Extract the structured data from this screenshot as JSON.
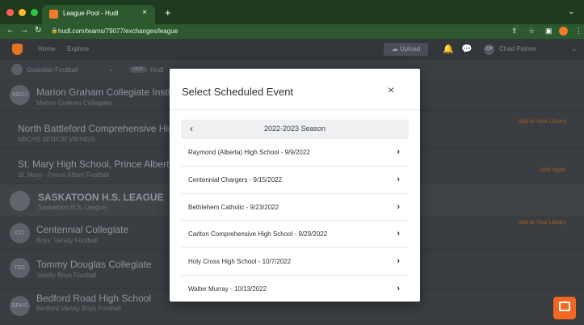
{
  "browser": {
    "tab_title": "League Pool - Hudl",
    "url": "hudl.com/teams/79077/exchanges/league"
  },
  "header": {
    "home_link": "Home",
    "explore_link": "Explore",
    "upload_label": "Upload",
    "avatar_initials": "CP",
    "user_name": "Chad Palmer"
  },
  "subbar": {
    "team_name": "Guardian Football",
    "pill_label": "NEW",
    "hudl_label": "Hudl"
  },
  "list": {
    "rows": [
      {
        "badge": "MGCI",
        "name": "Marion Graham Collegiate Institute",
        "sub": "Marion Graham Collegiate",
        "action": ""
      },
      {
        "badge": "",
        "name": "North Battleford Comprehensive High S",
        "sub": "NBCHS SENIOR VIKINGS",
        "action": "Add to Your Library"
      },
      {
        "badge": "",
        "name": "St. Mary High School, Prince Albert, Sa",
        "sub": "St. Mary - Prince Albert Football",
        "action": "Add Again"
      },
      {
        "badge": "",
        "name": "SASKATOON H.S. LEAGUE",
        "sub": "Saskatoon H.S. League",
        "action": ""
      },
      {
        "badge": "CCI",
        "name": "Centennial Collegiate",
        "sub": "Boys' Varsity Football",
        "action": "Add to Your Library"
      },
      {
        "badge": "TDC",
        "name": "Tommy Douglas Collegiate",
        "sub": "Varsity Boys Football",
        "action": ""
      },
      {
        "badge": "BRHS",
        "name": "Bedford Road High School",
        "sub": "Bedford Varsity Boys Football",
        "action": ""
      }
    ]
  },
  "modal": {
    "title": "Select Scheduled Event",
    "close_label": "×",
    "season_label": "2022-2023 Season",
    "back_label": "‹",
    "events": [
      "Raymond (Alberta) High School - 9/9/2022",
      "Centennial Chargers - 9/15/2022",
      "Bethlehem Catholic - 9/23/2022",
      "Carlton Comprehensive High School - 9/29/2022",
      "Holy Cross High School - 10/7/2022",
      "Walter Murray - 10/13/2022"
    ]
  },
  "colors": {
    "accent": "#f26722",
    "browser_bar": "#2c5a2e"
  }
}
